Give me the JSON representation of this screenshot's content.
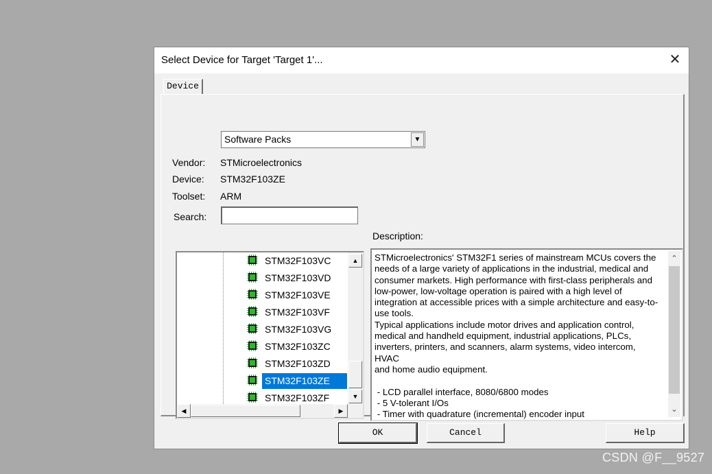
{
  "dialog": {
    "title": "Select Device for Target 'Target 1'...",
    "close_glyph": "✕"
  },
  "tabs": [
    {
      "label": "Device"
    }
  ],
  "source_combo": {
    "value": "Software Packs"
  },
  "fields": {
    "vendor_label": "Vendor:",
    "vendor_value": "STMicroelectronics",
    "device_label": "Device:",
    "device_value": "STM32F103ZE",
    "toolset_label": "Toolset:",
    "toolset_value": "ARM",
    "search_label": "Search:",
    "search_value": ""
  },
  "device_tree": {
    "items": [
      "STM32F103VC",
      "STM32F103VD",
      "STM32F103VE",
      "STM32F103VF",
      "STM32F103VG",
      "STM32F103ZC",
      "STM32F103ZD",
      "STM32F103ZE",
      "STM32F103ZF"
    ],
    "selected": "STM32F103ZE",
    "icon": "chip-icon"
  },
  "description": {
    "label": "Description:",
    "text": "STMicroelectronics' STM32F1 series of mainstream MCUs covers the\nneeds of a large variety of applications in the industrial, medical and\nconsumer markets. High performance with first-class peripherals and\nlow-power, low-voltage operation is paired with a high level of\nintegration at accessible prices with a simple architecture and easy-to-\nuse tools.\nTypical applications include motor drives and application control,\nmedical and handheld equipment, industrial applications, PLCs,\ninverters, printers, and scanners, alarm systems, video intercom, HVAC\nand home audio equipment.\n\n - LCD parallel interface, 8080/6800 modes\n - 5 V-tolerant I/Os\n - Timer with quadrature (incremental) encoder input"
  },
  "buttons": {
    "ok": "OK",
    "cancel": "Cancel",
    "help": "Help"
  },
  "watermark": "CSDN @F__9527",
  "colors": {
    "selection": "#0078d7",
    "chip_body": "#1a1a1a",
    "chip_accent": "#2db82d"
  }
}
